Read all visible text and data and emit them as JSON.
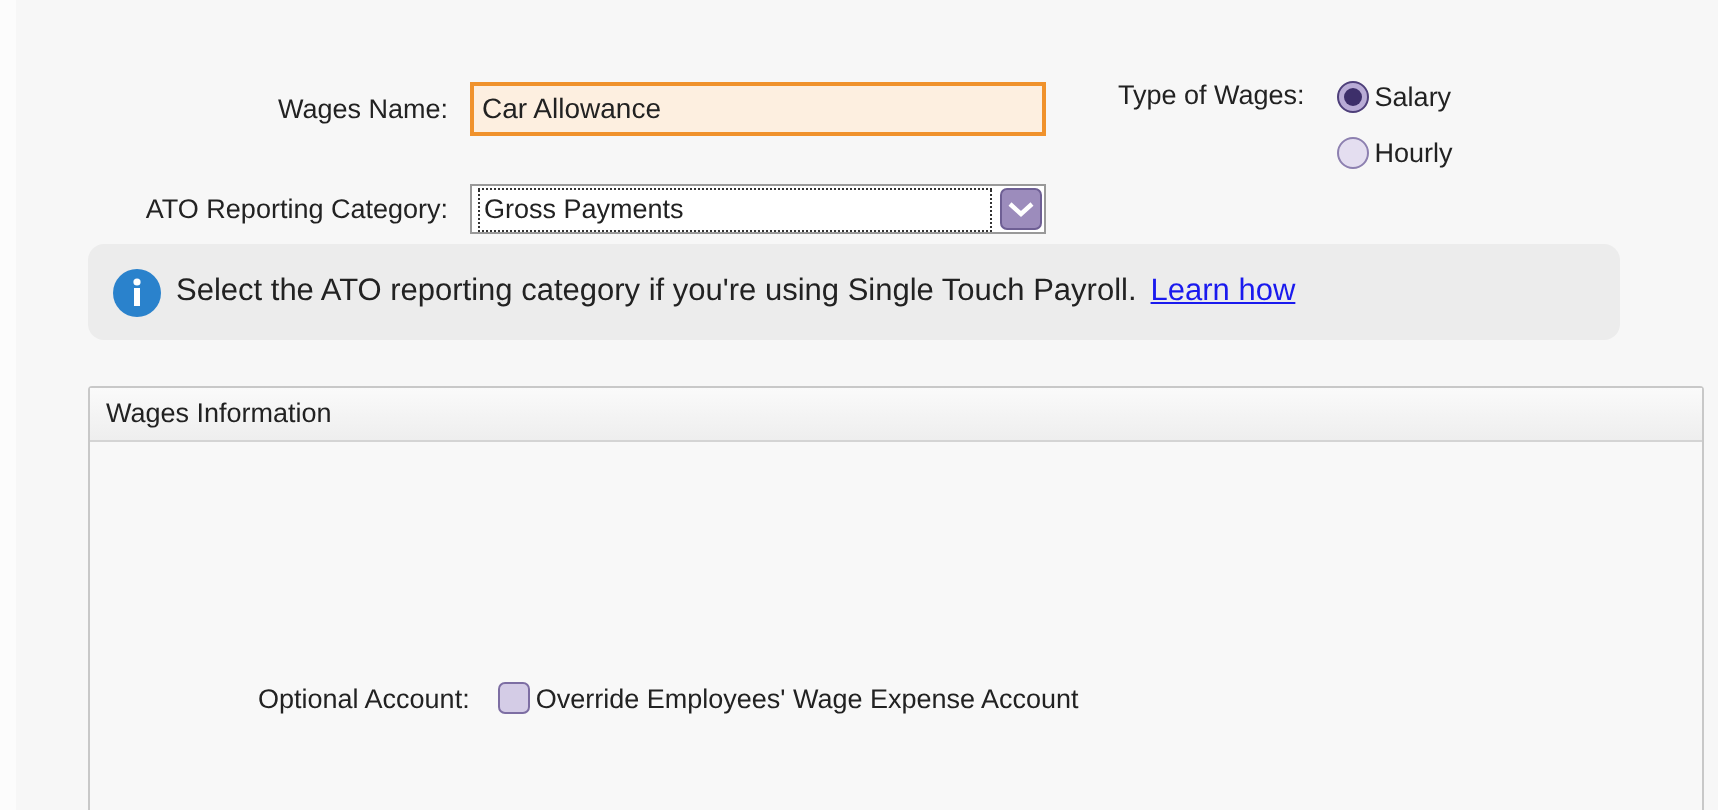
{
  "form": {
    "wages_name": {
      "label": "Wages Name:",
      "value": "Car Allowance"
    },
    "ato_category": {
      "label": "ATO Reporting Category:",
      "value": "Gross Payments"
    },
    "type_of_wages": {
      "label": "Type of Wages:",
      "options": [
        {
          "label": "Salary",
          "selected": true
        },
        {
          "label": "Hourly",
          "selected": false
        }
      ]
    }
  },
  "info": {
    "text": "Select the ATO reporting category if you're using Single Touch Payroll.",
    "link": "Learn how"
  },
  "panel": {
    "title": "Wages Information",
    "optional_account": {
      "label": "Optional Account:",
      "checkbox": {
        "label": "Override Employees' Wage Expense Account",
        "checked": false
      }
    }
  }
}
